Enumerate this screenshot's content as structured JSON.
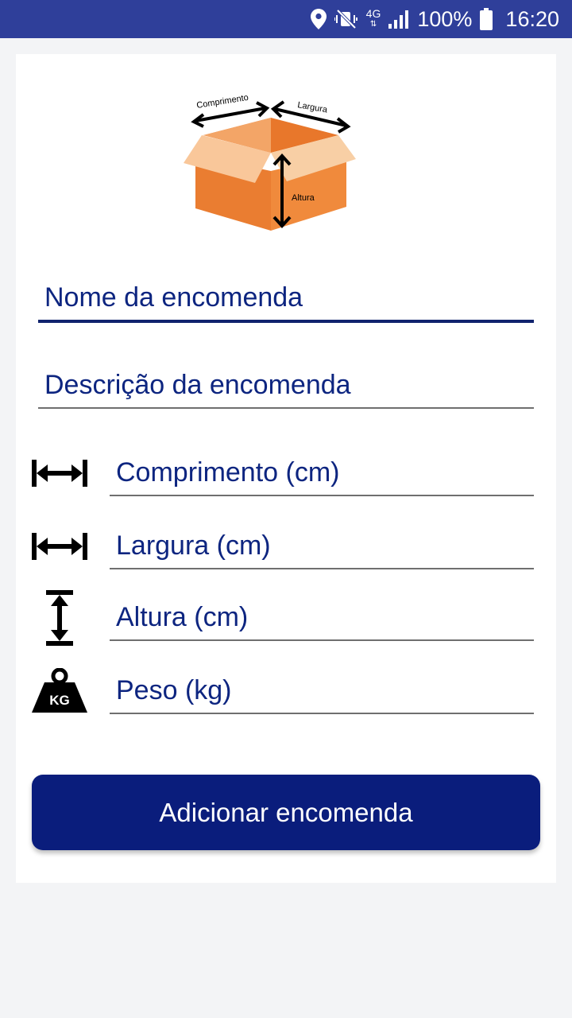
{
  "status_bar": {
    "network": "4G",
    "battery_percent": "100%",
    "time": "16:20"
  },
  "illustration": {
    "label_length": "Comprimento",
    "label_width": "Largura",
    "label_height": "Altura"
  },
  "form": {
    "name_placeholder": "Nome da encomenda",
    "description_placeholder": "Descrição da encomenda",
    "length_placeholder": "Comprimento (cm)",
    "width_placeholder": "Largura (cm)",
    "height_placeholder": "Altura (cm)",
    "weight_placeholder": "Peso (kg)",
    "weight_icon_text": "KG"
  },
  "actions": {
    "add_button_label": "Adicionar encomenda"
  },
  "colors": {
    "status_bar": "#2f3f9a",
    "accent": "#0a1d7c",
    "text": "#0d2580",
    "box_orange": "#ef8b3d"
  }
}
